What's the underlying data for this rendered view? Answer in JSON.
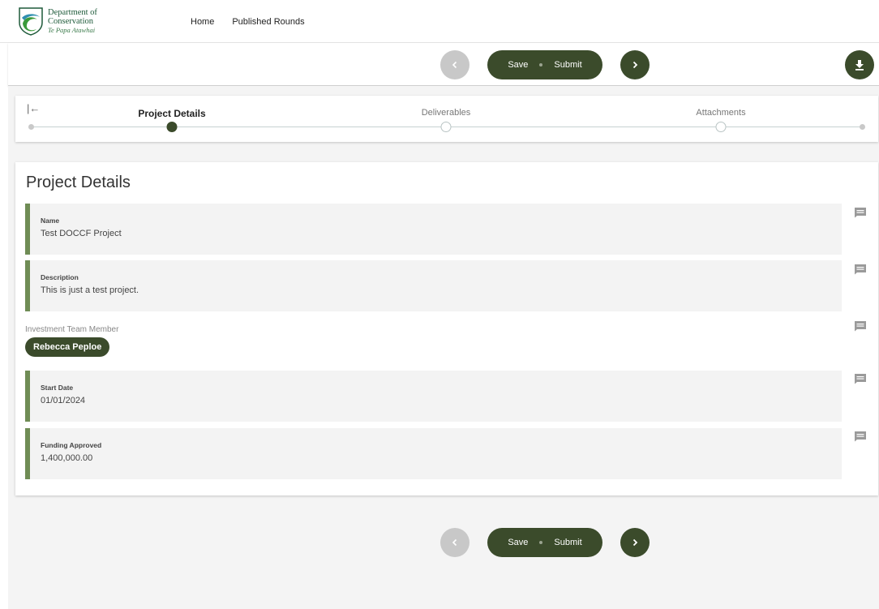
{
  "brand": {
    "line1": "Department of",
    "line2": "Conservation",
    "line3": "Te Papa Atawhai",
    "colors": {
      "primary": "#3b4b2b",
      "accent_bar": "#6f8c55",
      "logo_green": "#1e5a3a"
    }
  },
  "nav": {
    "home": "Home",
    "published_rounds": "Published Rounds"
  },
  "actions": {
    "save": "Save",
    "submit": "Submit",
    "prev_icon": "chevron-left-icon",
    "next_icon": "chevron-right-icon",
    "download_icon": "download-icon"
  },
  "stepper": {
    "steps": [
      {
        "label": "Project Details",
        "active": true
      },
      {
        "label": "Deliverables",
        "active": false
      },
      {
        "label": "Attachments",
        "active": false
      }
    ]
  },
  "project": {
    "title": "Project Details",
    "name_label": "Name",
    "name_value": "Test DOCCF Project",
    "description_label": "Description",
    "description_value": "This is just a test project.",
    "team_label": "Investment Team Member",
    "team_member": "Rebecca Peploe",
    "start_label": "Start Date",
    "start_value": "01/01/2024",
    "funding_label": "Funding Approved",
    "funding_value": "1,400,000.00"
  }
}
